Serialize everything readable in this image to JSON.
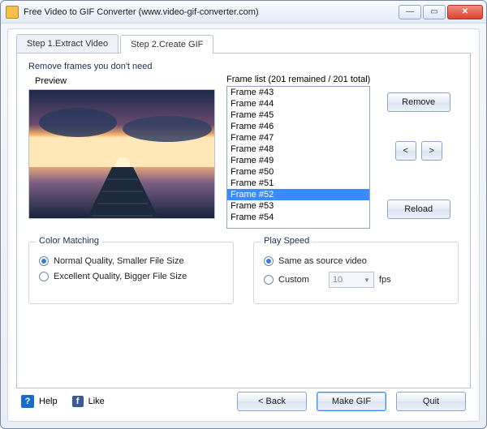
{
  "window": {
    "title": "Free Video to GIF Converter (www.video-gif-converter.com)"
  },
  "tabs": {
    "tab1": "Step 1.Extract Video",
    "tab2": "Step 2.Create GIF"
  },
  "frames": {
    "section_label": "Remove frames you don't need",
    "preview_label": "Preview",
    "list_label": "Frame list (201 remained / 201 total)",
    "items": [
      "Frame #43",
      "Frame #44",
      "Frame #45",
      "Frame #46",
      "Frame #47",
      "Frame #48",
      "Frame #49",
      "Frame #50",
      "Frame #51",
      "Frame #52",
      "Frame #53",
      "Frame #54"
    ],
    "selected_index": 9,
    "btn_remove": "Remove",
    "btn_prev": "<",
    "btn_next": ">",
    "btn_reload": "Reload"
  },
  "color_matching": {
    "title": "Color Matching",
    "opt_normal": "Normal Quality, Smaller File Size",
    "opt_excellent": "Excellent Quality, Bigger File Size",
    "selected": "normal"
  },
  "play_speed": {
    "title": "Play Speed",
    "opt_same": "Same as source video",
    "opt_custom": "Custom",
    "fps_value": "10",
    "fps_unit": "fps",
    "selected": "same"
  },
  "footer": {
    "help": "Help",
    "like": "Like",
    "back": "< Back",
    "make": "Make GIF",
    "quit": "Quit"
  }
}
